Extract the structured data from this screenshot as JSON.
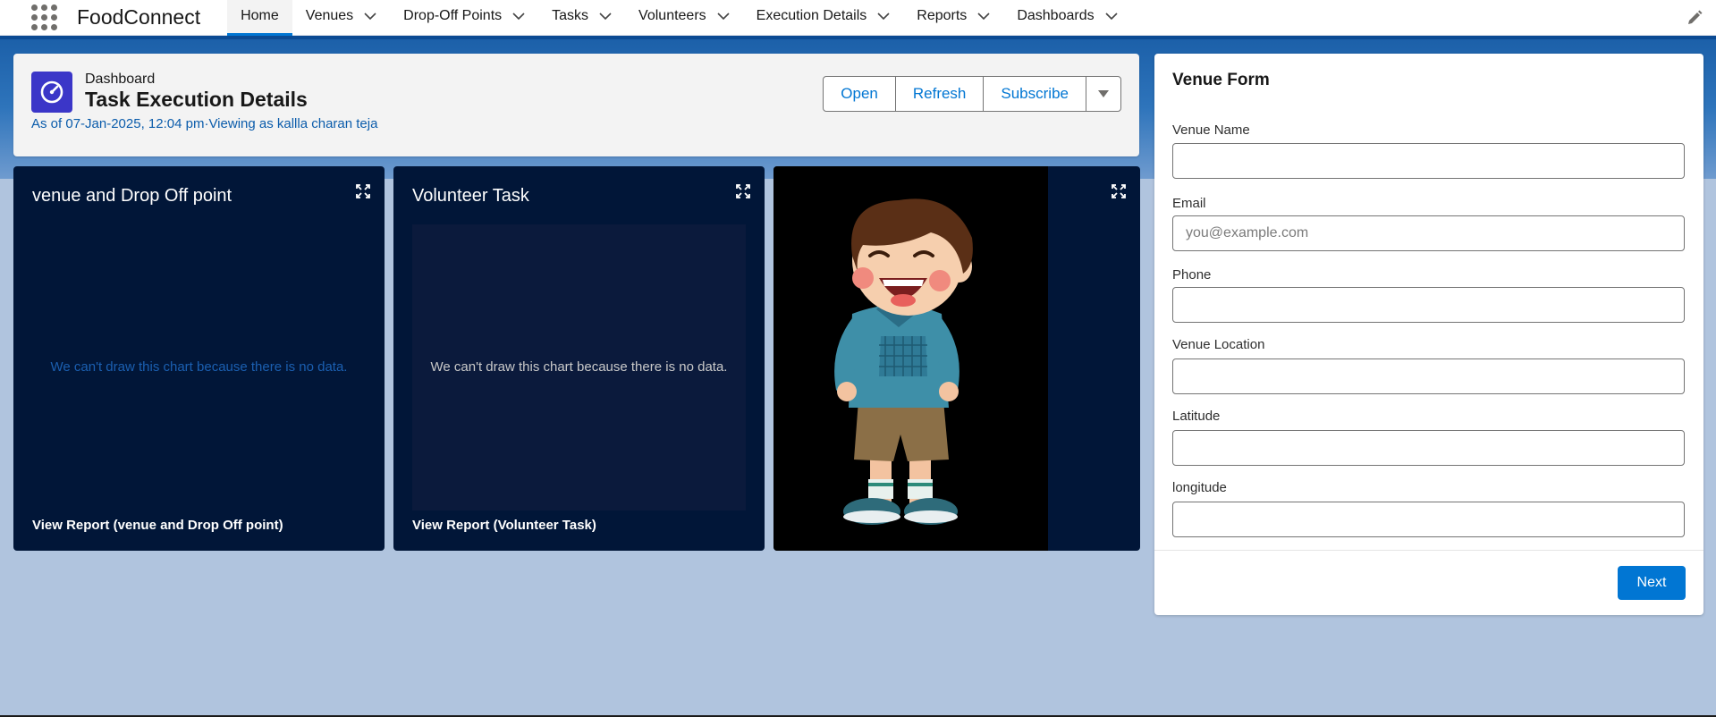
{
  "app": {
    "name": "FoodConnect"
  },
  "nav": {
    "items": [
      {
        "label": "Home",
        "active": true,
        "has_menu": false
      },
      {
        "label": "Venues",
        "active": false,
        "has_menu": true
      },
      {
        "label": "Drop-Off Points",
        "active": false,
        "has_menu": true
      },
      {
        "label": "Tasks",
        "active": false,
        "has_menu": true
      },
      {
        "label": "Volunteers",
        "active": false,
        "has_menu": true
      },
      {
        "label": "Execution Details",
        "active": false,
        "has_menu": true
      },
      {
        "label": "Reports",
        "active": false,
        "has_menu": true
      },
      {
        "label": "Dashboards",
        "active": false,
        "has_menu": true
      }
    ],
    "icons": {
      "launcher": "app-launcher-icon",
      "edit": "edit-pencil-icon"
    }
  },
  "dashboard": {
    "type_label": "Dashboard",
    "title": "Task Execution Details",
    "meta": "As of 07-Jan-2025, 12:04 pm·Viewing as kallla charan teja",
    "buttons": {
      "open": "Open",
      "refresh": "Refresh",
      "subscribe": "Subscribe"
    }
  },
  "tiles": [
    {
      "title": "venue and Drop Off point",
      "message": "We can't draw this chart because there is no data.",
      "link": "View Report (venue and Drop Off point)"
    },
    {
      "title": "Volunteer Task",
      "message": "We can't draw this chart because there is no data.",
      "link": "View Report (Volunteer Task)"
    },
    {
      "image": "cartoon-boy-laughing"
    }
  ],
  "form": {
    "title": "Venue Form",
    "fields": [
      {
        "label": "Venue Name",
        "placeholder": "",
        "value": ""
      },
      {
        "label": "Email",
        "placeholder": "you@example.com",
        "value": ""
      },
      {
        "label": "Phone",
        "placeholder": "",
        "value": ""
      },
      {
        "label": "Venue Location",
        "placeholder": "",
        "value": ""
      },
      {
        "label": "Latitude",
        "placeholder": "",
        "value": ""
      },
      {
        "label": "longitude",
        "placeholder": "",
        "value": ""
      }
    ],
    "next_label": "Next"
  },
  "colors": {
    "accent": "#0176d3",
    "tile_bg": "#011638",
    "dashboard_icon": "#3b36c8",
    "no_data_text_1": "#1b5fb0",
    "no_data_text_2": "#c9c9c9"
  }
}
